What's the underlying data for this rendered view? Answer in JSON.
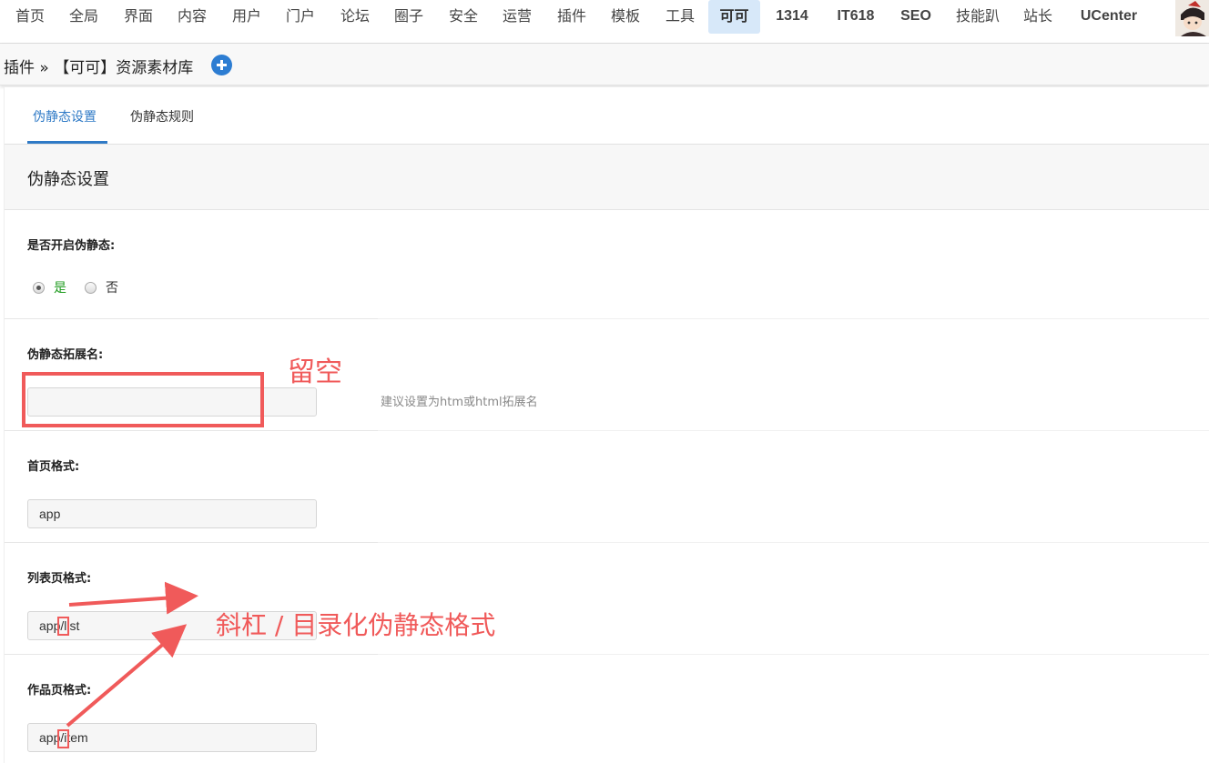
{
  "nav": {
    "items": [
      {
        "label": "首页"
      },
      {
        "label": "全局"
      },
      {
        "label": "界面"
      },
      {
        "label": "内容"
      },
      {
        "label": "用户"
      },
      {
        "label": "门户"
      },
      {
        "label": "论坛"
      },
      {
        "label": "圈子"
      },
      {
        "label": "安全"
      },
      {
        "label": "运营"
      },
      {
        "label": "插件"
      },
      {
        "label": "模板"
      },
      {
        "label": "工具"
      },
      {
        "label": "可可",
        "active": true
      },
      {
        "label": "1314"
      },
      {
        "label": "IT618"
      },
      {
        "label": "SEO"
      },
      {
        "label": "技能趴"
      },
      {
        "label": "站长"
      },
      {
        "label": "UCenter"
      }
    ],
    "active_bg": "#d7e8f9"
  },
  "breadcrumb": {
    "text": "插件 » 【可可】资源素材库"
  },
  "tabs": [
    {
      "label": "伪静态设置",
      "active": true
    },
    {
      "label": "伪静态规则"
    }
  ],
  "section": {
    "title": "伪静态设置"
  },
  "form": {
    "rewrite_enable": {
      "label": "是否开启伪静态:",
      "options": [
        {
          "label": "是",
          "checked": true
        },
        {
          "label": "否",
          "checked": false
        }
      ]
    },
    "extension": {
      "label": "伪静态拓展名:",
      "value": "",
      "hint": "建议设置为htm或html拓展名"
    },
    "home_format": {
      "label": "首页格式:",
      "value": "app"
    },
    "list_format": {
      "label": "列表页格式:",
      "value": "app/list"
    },
    "item_format": {
      "label": "作品页格式:",
      "value": "app/item"
    }
  },
  "annotations": {
    "leave_empty": "留空",
    "slash_note": "斜杠 /  目录化伪静态格式",
    "color": "#f05a5a"
  },
  "colors": {
    "accent": "#2f7ac6",
    "plus_button": "#2d7dd2",
    "yes_label": "#1c9a1c"
  }
}
